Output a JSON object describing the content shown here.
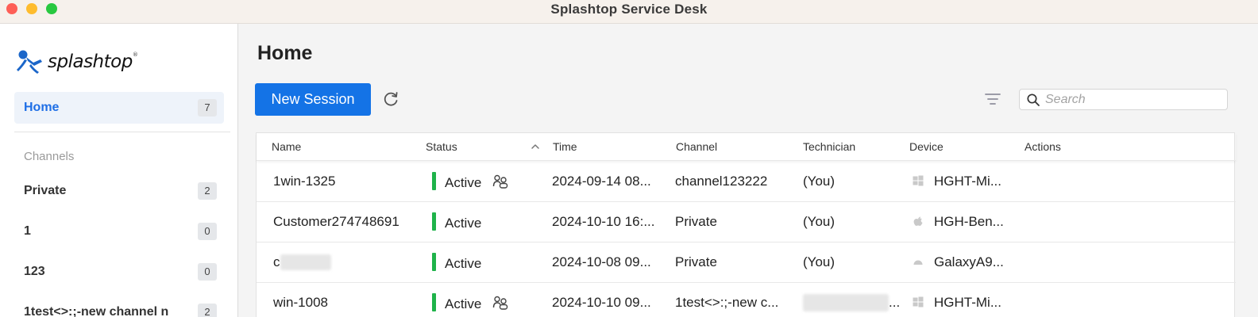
{
  "window": {
    "title": "Splashtop Service Desk"
  },
  "brand": {
    "name": "splashtop",
    "reg": "®"
  },
  "sidebar": {
    "home": {
      "label": "Home",
      "count": "7"
    },
    "channels_label": "Channels",
    "channels": [
      {
        "label": "Private",
        "count": "2"
      },
      {
        "label": "1",
        "count": "0"
      },
      {
        "label": "123",
        "count": "0"
      },
      {
        "label": "1test<>:;-new channel n",
        "count": "2"
      }
    ]
  },
  "main": {
    "title": "Home",
    "new_session_label": "New Session",
    "search": {
      "placeholder": "Search",
      "value": ""
    }
  },
  "table": {
    "columns": {
      "name": "Name",
      "status": "Status",
      "time": "Time",
      "channel": "Channel",
      "technician": "Technician",
      "device": "Device",
      "actions": "Actions"
    },
    "rows": [
      {
        "name": "1win-1325",
        "status": "Active",
        "time": "2024-09-14 08...",
        "channel": "channel123222",
        "technician": "(You)",
        "device": "HGHT-Mi...",
        "os": "windows-icon",
        "group": true
      },
      {
        "name": "Customer274748691",
        "status": "Active",
        "time": "2024-10-10 16:...",
        "channel": "Private",
        "technician": "(You)",
        "device": "HGH-Ben...",
        "os": "apple-icon",
        "group": false
      },
      {
        "name": "c",
        "status": "Active",
        "time": "2024-10-08 09...",
        "channel": "Private",
        "technician": "(You)",
        "device": "GalaxyA9...",
        "os": "android-icon",
        "group": false
      },
      {
        "name": "win-1008",
        "status": "Active",
        "time": "2024-10-10 09...",
        "channel": "1test<>:;-new c...",
        "technician": "...",
        "device": "HGHT-Mi...",
        "os": "windows-icon",
        "group": true
      }
    ]
  },
  "colors": {
    "accent": "#1473e6",
    "active": "#1fb34a",
    "home_bg": "#eef3fa"
  }
}
